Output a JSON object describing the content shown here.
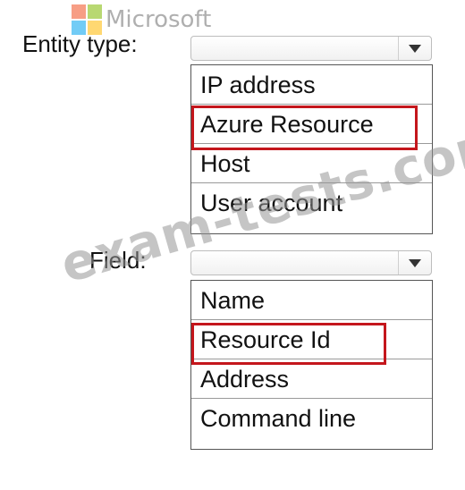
{
  "brand": {
    "name": "Microsoft",
    "logo_colors": [
      "#f25022",
      "#7fba00",
      "#00a4ef",
      "#ffb900"
    ]
  },
  "entity_type": {
    "label": "Entity type:",
    "value": "",
    "options": [
      "IP address",
      "Azure Resource",
      "Host",
      "User account"
    ],
    "highlighted_option": "Azure Resource"
  },
  "field": {
    "label": "Field:",
    "value": "",
    "options": [
      "Name",
      "Resource Id",
      "Address",
      "Command line"
    ],
    "highlighted_option": "Resource Id"
  },
  "watermark": {
    "text": "exam-tests.com"
  },
  "colors": {
    "highlight": "#c4161c",
    "list_border": "#555555",
    "watermark": "#969696"
  },
  "icons": {
    "dropdown": "chevron-down-icon"
  }
}
